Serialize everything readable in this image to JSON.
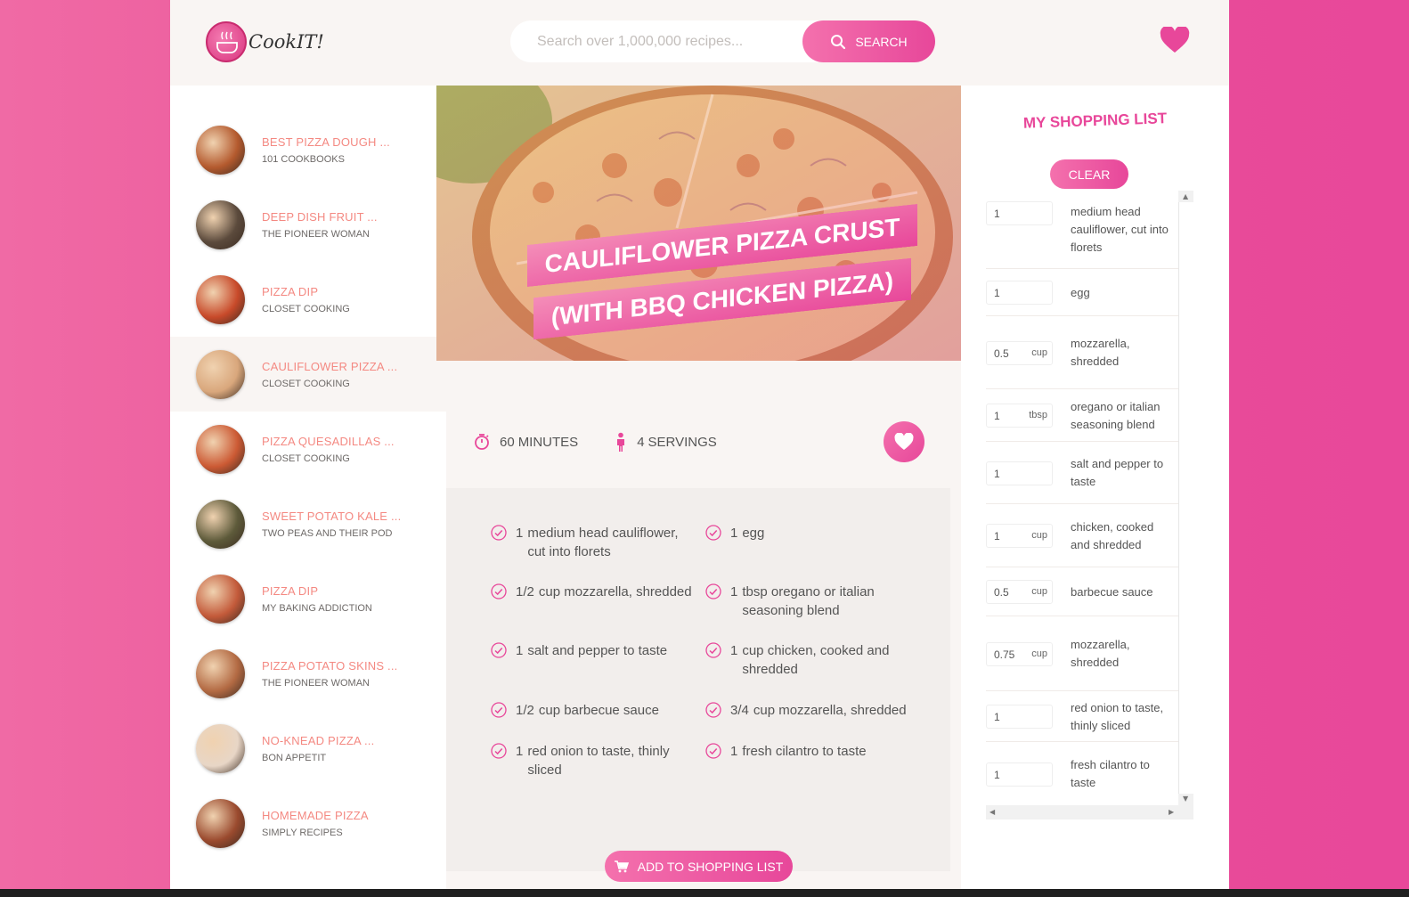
{
  "brand": {
    "name": "CookIT!"
  },
  "search": {
    "placeholder": "Search over 1,000,000 recipes...",
    "button_label": "SEARCH"
  },
  "results": [
    {
      "title": "BEST PIZZA DOUGH ...",
      "author": "101 COOKBOOKS",
      "thumb_color": "#b45a2e"
    },
    {
      "title": "DEEP DISH FRUIT ...",
      "author": "THE PIONEER WOMAN",
      "thumb_color": "#5b4a3c"
    },
    {
      "title": "PIZZA DIP",
      "author": "CLOSET COOKING",
      "thumb_color": "#c84a2a"
    },
    {
      "title": "CAULIFLOWER PIZZA ...",
      "author": "CLOSET COOKING",
      "thumb_color": "#d9a77c",
      "active": true
    },
    {
      "title": "PIZZA QUESADILLAS ...",
      "author": "CLOSET COOKING",
      "thumb_color": "#cc5a34"
    },
    {
      "title": "SWEET POTATO KALE ...",
      "author": "TWO PEAS AND THEIR POD",
      "thumb_color": "#5d5a3a"
    },
    {
      "title": "PIZZA DIP",
      "author": "MY BAKING ADDICTION",
      "thumb_color": "#c35a3a"
    },
    {
      "title": "PIZZA POTATO SKINS ...",
      "author": "THE PIONEER WOMAN",
      "thumb_color": "#b36a43"
    },
    {
      "title": "NO-KNEAD PIZZA ...",
      "author": "BON APPETIT",
      "thumb_color": "#e8d6c6"
    },
    {
      "title": "HOMEMADE PIZZA",
      "author": "SIMPLY RECIPES",
      "thumb_color": "#9a4a2e"
    }
  ],
  "recipe": {
    "title": "CAULIFLOWER PIZZA CRUST (WITH BBQ CHICKEN PIZZA)",
    "time": "60",
    "time_unit": "MINUTES",
    "servings": "4",
    "servings_unit": "SERVINGS",
    "ingredients": [
      {
        "qty": "1",
        "text": "medium head cauliflower, cut into florets"
      },
      {
        "qty": "1",
        "text": "egg"
      },
      {
        "qty": "1/2",
        "text": "cup mozzarella, shredded"
      },
      {
        "qty": "1",
        "text": "tbsp oregano or italian seasoning blend"
      },
      {
        "qty": "1",
        "text": "salt and pepper to taste"
      },
      {
        "qty": "1",
        "text": "cup chicken, cooked and shredded"
      },
      {
        "qty": "1/2",
        "text": "cup barbecue sauce"
      },
      {
        "qty": "3/4",
        "text": "cup mozzarella, shredded"
      },
      {
        "qty": "1",
        "text": "red onion to taste, thinly sliced"
      },
      {
        "qty": "1",
        "text": "fresh cilantro to taste"
      }
    ],
    "add_button": "ADD TO SHOPPING LIST"
  },
  "shopping": {
    "title": "MY SHOPPING LIST",
    "clear_label": "CLEAR",
    "items": [
      {
        "count": "1",
        "unit": "",
        "desc": "medium head cauliflower, cut into florets"
      },
      {
        "count": "1",
        "unit": "",
        "desc": "egg"
      },
      {
        "count": "0.5",
        "unit": "cup",
        "desc": "mozzarella, shredded"
      },
      {
        "count": "1",
        "unit": "tbsp",
        "desc": "oregano or italian seasoning blend"
      },
      {
        "count": "1",
        "unit": "",
        "desc": "salt and pepper to taste"
      },
      {
        "count": "1",
        "unit": "cup",
        "desc": "chicken, cooked and shredded"
      },
      {
        "count": "0.5",
        "unit": "cup",
        "desc": "barbecue sauce"
      },
      {
        "count": "0.75",
        "unit": "cup",
        "desc": "mozzarella, shredded"
      },
      {
        "count": "1",
        "unit": "",
        "desc": "red onion to taste, thinly sliced"
      },
      {
        "count": "1",
        "unit": "",
        "desc": "fresh cilantro to taste"
      }
    ]
  },
  "colors": {
    "accent": "#e8479a",
    "accent_light": "#f471ad",
    "title_pink": "#f48982"
  }
}
